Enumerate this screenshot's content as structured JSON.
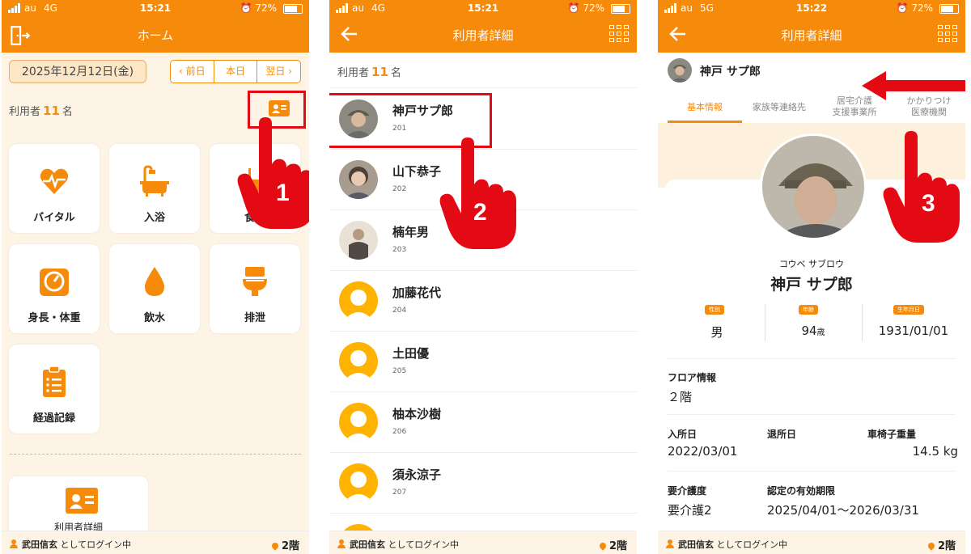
{
  "colors": {
    "accent": "#f58a0b",
    "highlight": "#e40a14"
  },
  "status": [
    {
      "carrier": "au",
      "net": "4G",
      "time": "15:21",
      "battery": "72%"
    },
    {
      "carrier": "au",
      "net": "4G",
      "time": "15:21",
      "battery": "72%"
    },
    {
      "carrier": "au",
      "net": "5G",
      "time": "15:22",
      "battery": "72%"
    }
  ],
  "s1": {
    "title": "ホーム",
    "date": "2025年12月12日(金)",
    "prev": "前日",
    "today": "本日",
    "next": "翌日",
    "users_label": "利用者",
    "users_count": "11",
    "users_unit": "名",
    "tiles": [
      "バイタル",
      "入浴",
      "食事",
      "身長・体重",
      "飲水",
      "排泄",
      "経過記録"
    ],
    "detail_tile": "利用者詳細",
    "step": "1"
  },
  "s2": {
    "title": "利用者詳細",
    "users_label": "利用者",
    "users_count": "11",
    "users_unit": "名",
    "residents": [
      {
        "name": "神戸サプ郎",
        "room": "201"
      },
      {
        "name": "山下恭子",
        "room": "202"
      },
      {
        "name": "楠年男",
        "room": "203"
      },
      {
        "name": "加藤花代",
        "room": "204"
      },
      {
        "name": "土田優",
        "room": "205"
      },
      {
        "name": "柚本沙樹",
        "room": "206"
      },
      {
        "name": "須永涼子",
        "room": "207"
      }
    ],
    "step": "2"
  },
  "s3": {
    "title": "利用者詳細",
    "header_name": "神戸 サプ郎",
    "tabs": [
      "基本情報",
      "家族等連絡先",
      "居宅介護\n支援事業所",
      "かかりつけ\n医療機関"
    ],
    "kana": "コウベ サブロウ",
    "name": "神戸 サプ郎",
    "gender_label": "性別",
    "gender": "男",
    "age_label": "年齢",
    "age": "94",
    "age_unit": "歳",
    "birth_label": "生年月日",
    "birth": "1931/01/01",
    "floor_label": "フロア情報",
    "floor": "２階",
    "admit_label": "入所日",
    "admit": "2022/03/01",
    "leave_label": "退所日",
    "wheel_label": "車椅子重量",
    "wheel": "14.5 kg",
    "care_label": "要介護度",
    "care": "要介護2",
    "valid_label": "認定の有効期限",
    "valid": "2025/04/01～2026/03/31",
    "step": "3"
  },
  "footer": {
    "user": "武田信玄",
    "suffix": "としてログイン中",
    "floor": "2階"
  }
}
